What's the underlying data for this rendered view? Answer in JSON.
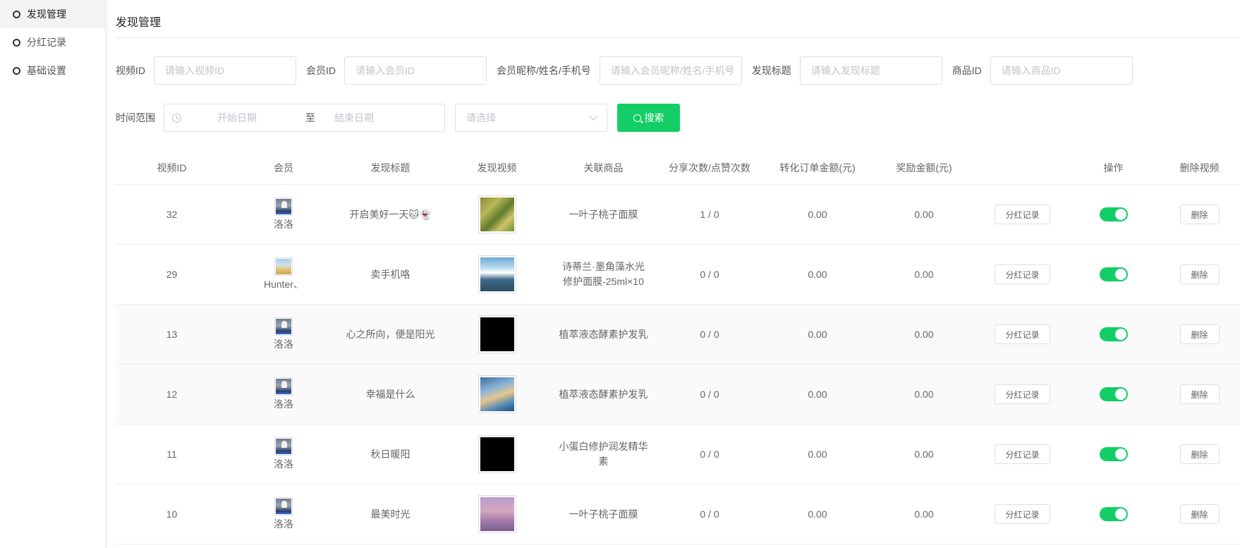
{
  "sidebar": {
    "items": [
      {
        "label": "发现管理",
        "active": true
      },
      {
        "label": "分红记录",
        "active": false
      },
      {
        "label": "基础设置",
        "active": false
      }
    ]
  },
  "page": {
    "title": "发现管理"
  },
  "filters": {
    "video_id": {
      "label": "视频ID",
      "placeholder": "请输入视频ID"
    },
    "member_id": {
      "label": "会员ID",
      "placeholder": "请输入会员ID"
    },
    "member_info": {
      "label": "会员昵称/姓名/手机号",
      "placeholder": "请输入会员昵称/姓名/手机号"
    },
    "title": {
      "label": "发现标题",
      "placeholder": "请输入发现标题"
    },
    "goods_id": {
      "label": "商品ID",
      "placeholder": "请输入商品ID"
    },
    "time_range": {
      "label": "时间范围",
      "start_placeholder": "开始日期",
      "separator": "至",
      "end_placeholder": "结束日期"
    },
    "select": {
      "placeholder": "请选择"
    },
    "search_label": "搜索"
  },
  "table": {
    "headers": [
      "视频ID",
      "会员",
      "发现标题",
      "发现视频",
      "关联商品",
      "分享次数/点赞次数",
      "转化订单金额(元)",
      "奖励金额(元)",
      "",
      "操作",
      "删除视频"
    ],
    "rows": [
      {
        "id": "32",
        "member": "洛洛",
        "avatar": "person",
        "title": "开启美好一天🐱👻",
        "thumb": "green",
        "goods": "一叶子桃子面膜",
        "counts": "1 / 0",
        "order_amount": "0.00",
        "reward": "0.00",
        "record_btn": "分红记录",
        "enabled": true,
        "delete_btn": "删除"
      },
      {
        "id": "29",
        "member": "Hunter、",
        "avatar": "sunset",
        "title": "卖手机咯",
        "thumb": "mountain",
        "goods": "诗蒂兰·墨角藻水光修护面膜-25ml×10",
        "counts": "0 / 0",
        "order_amount": "0.00",
        "reward": "0.00",
        "record_btn": "分红记录",
        "enabled": true,
        "delete_btn": "删除"
      },
      {
        "id": "13",
        "member": "洛洛",
        "avatar": "person",
        "title": "心之所向，便是阳光",
        "thumb": "black",
        "goods": "植萃液态酵素护发乳",
        "counts": "0 / 0",
        "order_amount": "0.00",
        "reward": "0.00",
        "record_btn": "分红记录",
        "enabled": true,
        "delete_btn": "删除"
      },
      {
        "id": "12",
        "member": "洛洛",
        "avatar": "person",
        "title": "幸福是什么",
        "thumb": "sky",
        "goods": "植萃液态酵素护发乳",
        "counts": "0 / 0",
        "order_amount": "0.00",
        "reward": "0.00",
        "record_btn": "分红记录",
        "enabled": true,
        "delete_btn": "删除"
      },
      {
        "id": "11",
        "member": "洛洛",
        "avatar": "person",
        "title": "秋日暖阳",
        "thumb": "black",
        "goods": "小蛋白修护润发精华素",
        "counts": "0 / 0",
        "order_amount": "0.00",
        "reward": "0.00",
        "record_btn": "分红记录",
        "enabled": true,
        "delete_btn": "删除"
      },
      {
        "id": "10",
        "member": "洛洛",
        "avatar": "person",
        "title": "最美时光",
        "thumb": "pink",
        "goods": "一叶子桃子面膜",
        "counts": "0 / 0",
        "order_amount": "0.00",
        "reward": "0.00",
        "record_btn": "分红记录",
        "enabled": true,
        "delete_btn": "删除"
      }
    ]
  },
  "colors": {
    "accent": "#13ce66",
    "border": "#dcdfe6"
  }
}
